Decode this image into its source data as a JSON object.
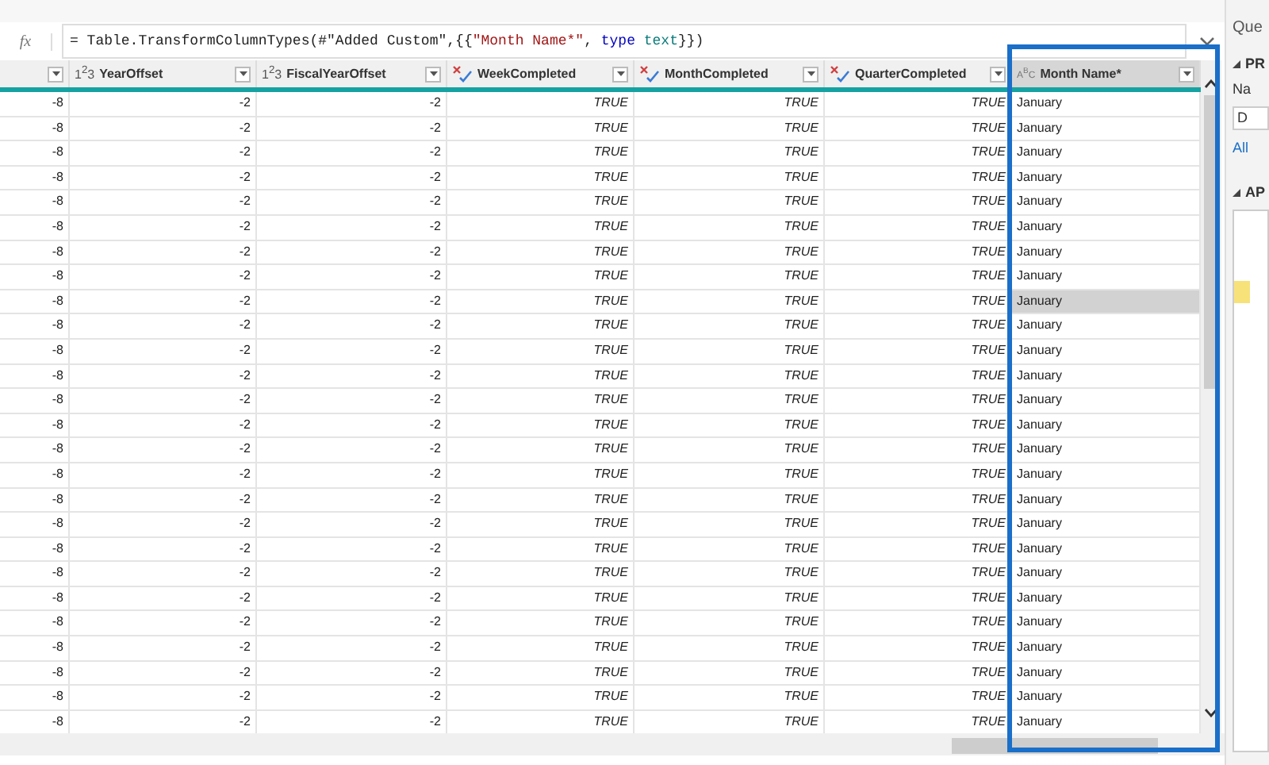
{
  "formula_bar": {
    "fx_label": "fx",
    "segments": [
      {
        "text": "= Table.TransformColumnTypes(#\"Added Custom\",{{",
        "kind": "code"
      },
      {
        "text": "\"Month Name*\"",
        "kind": "string"
      },
      {
        "text": ", ",
        "kind": "code"
      },
      {
        "text": "type",
        "kind": "keyword"
      },
      {
        "text": " text",
        "kind": "typename"
      },
      {
        "text": "}})",
        "kind": "code"
      }
    ]
  },
  "table": {
    "columns": [
      {
        "kind": "plain"
      },
      {
        "name": "YearOffset",
        "kind": "number",
        "type_label": "1$^{2}$3"
      },
      {
        "name": "FiscalYearOffset",
        "kind": "number",
        "type_label": "1$^{2}$3"
      },
      {
        "name": "WeekCompleted",
        "kind": "logical"
      },
      {
        "name": "MonthCompleted",
        "kind": "logical"
      },
      {
        "name": "QuarterCompleted",
        "kind": "logical"
      },
      {
        "name": "Month Name*",
        "kind": "text",
        "type_label": "A$^{B}$C",
        "selected": true
      }
    ],
    "rows": [
      {
        "cells": [
          "-8",
          "-2",
          "-2",
          "TRUE",
          "TRUE",
          "TRUE",
          "January"
        ],
        "selected": false
      },
      {
        "cells": [
          "-8",
          "-2",
          "-2",
          "TRUE",
          "TRUE",
          "TRUE",
          "January"
        ],
        "selected": false
      },
      {
        "cells": [
          "-8",
          "-2",
          "-2",
          "TRUE",
          "TRUE",
          "TRUE",
          "January"
        ],
        "selected": false
      },
      {
        "cells": [
          "-8",
          "-2",
          "-2",
          "TRUE",
          "TRUE",
          "TRUE",
          "January"
        ],
        "selected": false
      },
      {
        "cells": [
          "-8",
          "-2",
          "-2",
          "TRUE",
          "TRUE",
          "TRUE",
          "January"
        ],
        "selected": false
      },
      {
        "cells": [
          "-8",
          "-2",
          "-2",
          "TRUE",
          "TRUE",
          "TRUE",
          "January"
        ],
        "selected": false
      },
      {
        "cells": [
          "-8",
          "-2",
          "-2",
          "TRUE",
          "TRUE",
          "TRUE",
          "January"
        ],
        "selected": false
      },
      {
        "cells": [
          "-8",
          "-2",
          "-2",
          "TRUE",
          "TRUE",
          "TRUE",
          "January"
        ],
        "selected": false
      },
      {
        "cells": [
          "-8",
          "-2",
          "-2",
          "TRUE",
          "TRUE",
          "TRUE",
          "January"
        ],
        "selected": true
      },
      {
        "cells": [
          "-8",
          "-2",
          "-2",
          "TRUE",
          "TRUE",
          "TRUE",
          "January"
        ],
        "selected": false
      },
      {
        "cells": [
          "-8",
          "-2",
          "-2",
          "TRUE",
          "TRUE",
          "TRUE",
          "January"
        ],
        "selected": false
      },
      {
        "cells": [
          "-8",
          "-2",
          "-2",
          "TRUE",
          "TRUE",
          "TRUE",
          "January"
        ],
        "selected": false
      },
      {
        "cells": [
          "-8",
          "-2",
          "-2",
          "TRUE",
          "TRUE",
          "TRUE",
          "January"
        ],
        "selected": false
      },
      {
        "cells": [
          "-8",
          "-2",
          "-2",
          "TRUE",
          "TRUE",
          "TRUE",
          "January"
        ],
        "selected": false
      },
      {
        "cells": [
          "-8",
          "-2",
          "-2",
          "TRUE",
          "TRUE",
          "TRUE",
          "January"
        ],
        "selected": false
      },
      {
        "cells": [
          "-8",
          "-2",
          "-2",
          "TRUE",
          "TRUE",
          "TRUE",
          "January"
        ],
        "selected": false
      },
      {
        "cells": [
          "-8",
          "-2",
          "-2",
          "TRUE",
          "TRUE",
          "TRUE",
          "January"
        ],
        "selected": false
      },
      {
        "cells": [
          "-8",
          "-2",
          "-2",
          "TRUE",
          "TRUE",
          "TRUE",
          "January"
        ],
        "selected": false
      },
      {
        "cells": [
          "-8",
          "-2",
          "-2",
          "TRUE",
          "TRUE",
          "TRUE",
          "January"
        ],
        "selected": false
      },
      {
        "cells": [
          "-8",
          "-2",
          "-2",
          "TRUE",
          "TRUE",
          "TRUE",
          "January"
        ],
        "selected": false
      },
      {
        "cells": [
          "-8",
          "-2",
          "-2",
          "TRUE",
          "TRUE",
          "TRUE",
          "January"
        ],
        "selected": false
      },
      {
        "cells": [
          "-8",
          "-2",
          "-2",
          "TRUE",
          "TRUE",
          "TRUE",
          "January"
        ],
        "selected": false
      },
      {
        "cells": [
          "-8",
          "-2",
          "-2",
          "TRUE",
          "TRUE",
          "TRUE",
          "January"
        ],
        "selected": false
      },
      {
        "cells": [
          "-8",
          "-2",
          "-2",
          "TRUE",
          "TRUE",
          "TRUE",
          "January"
        ],
        "selected": false
      },
      {
        "cells": [
          "-8",
          "-2",
          "-2",
          "TRUE",
          "TRUE",
          "TRUE",
          "January"
        ],
        "selected": false
      },
      {
        "cells": [
          "-8",
          "-2",
          "-2",
          "TRUE",
          "TRUE",
          "TRUE",
          "January"
        ],
        "selected": false
      }
    ]
  },
  "query_settings": {
    "title": "Que",
    "properties_heading": "PR",
    "name_label": "Na",
    "name_value": "D",
    "all_properties_link": "All",
    "applied_steps_heading": "AP"
  }
}
